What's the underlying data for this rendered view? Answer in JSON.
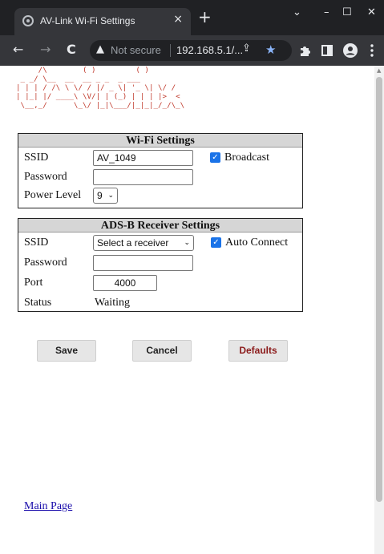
{
  "browser": {
    "tab_title": "AV-Link Wi-Fi Settings",
    "tab_close": "×",
    "new_tab": "+",
    "window_controls": {
      "dropdown": "⌄",
      "minimize": "–",
      "maximize": "☐",
      "close": "✕"
    },
    "nav": {
      "back": "←",
      "forward": "→",
      "reload": "C"
    },
    "address_warning_icon": "▲",
    "not_secure": "Not secure",
    "url": "192.168.5.1/...",
    "icons": [
      "share-icon",
      "star-icon",
      "extensions-icon",
      "sidepanel-icon",
      "profile-icon",
      "menu-icon"
    ]
  },
  "logo_art": "     /\\        ( )         ( )\n _ _/ \\__  __  __ _ _  _ ___\n| | | / /\\ \\ \\/ / |/ _ \\| '_ \\| \\/ /\n| |_| |/ ____\\ \\V/| | (_) | | | |>  <\n \\__,_/      \\_\\/ |_|\\___/|_|_|_/_/\\_\\",
  "wifi": {
    "header": "Wi-Fi Settings",
    "ssid_label": "SSID",
    "ssid_value": "AV_1049",
    "broadcast_label": "Broadcast",
    "password_label": "Password",
    "password_value": "",
    "power_label": "Power Level",
    "power_value": "9"
  },
  "adsb": {
    "header": "ADS-B Receiver Settings",
    "ssid_label": "SSID",
    "ssid_select": "Select a receiver",
    "auto_connect_label": "Auto Connect",
    "password_label": "Password",
    "password_value": "",
    "port_label": "Port",
    "port_value": "4000",
    "status_label": "Status",
    "status_value": "Waiting"
  },
  "buttons": {
    "save": "Save",
    "cancel": "Cancel",
    "defaults": "Defaults"
  },
  "main_link": "Main Page",
  "colors": {
    "accent": "#1a73e8",
    "logo": "#c0392b",
    "defaults_text": "#8b1a1a"
  }
}
